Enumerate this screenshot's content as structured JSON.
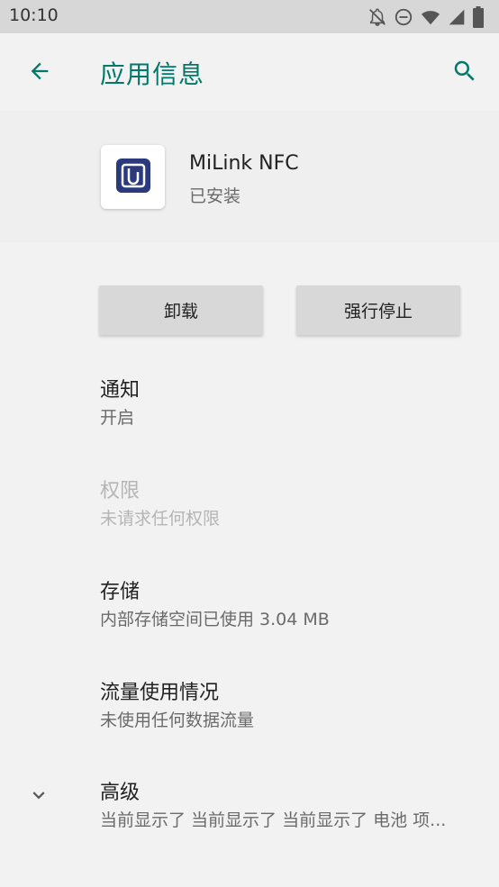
{
  "status_bar": {
    "time": "10:10",
    "icons": [
      "notifications-off-icon",
      "do-not-disturb-icon",
      "wifi-icon",
      "cell-signal-icon",
      "battery-icon"
    ]
  },
  "app_bar": {
    "back_icon": "arrow-back-icon",
    "title": "应用信息",
    "search_icon": "search-icon",
    "accent_color": "#00796b"
  },
  "app": {
    "name": "MiLink NFC",
    "status": "已安装",
    "icon": "milink-nfc-app-icon",
    "icon_color": "#2b3a7d"
  },
  "actions": {
    "uninstall": "卸载",
    "force_stop": "强行停止"
  },
  "prefs": [
    {
      "title": "通知",
      "summary": "开启",
      "enabled": true
    },
    {
      "title": "权限",
      "summary": "未请求任何权限",
      "enabled": false
    },
    {
      "title": "存储",
      "summary": "内部存储空间已使用 3.04 MB",
      "enabled": true
    },
    {
      "title": "流量使用情况",
      "summary": "未使用任何数据流量",
      "enabled": true
    }
  ],
  "advanced": {
    "title": "高级",
    "summary": "当前显示了 当前显示了 当前显示了 电池 项...",
    "icon": "chevron-down-icon"
  }
}
